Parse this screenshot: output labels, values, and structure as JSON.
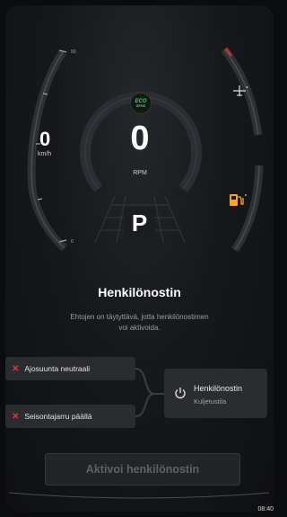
{
  "speedometer": {
    "value": "0",
    "unit": "km/h",
    "tick_top": "50",
    "tick_bottom": "0"
  },
  "tachometer": {
    "value": "0",
    "label": "RPM"
  },
  "eco_badge": {
    "line1": "ECO",
    "line2": "DRIVE"
  },
  "gear": {
    "selected": "P"
  },
  "indicators": {
    "aircraft_icon": "airplane-icon",
    "fuel_icon": "fuel-pump-icon",
    "fuel_color": "#f2a23a"
  },
  "dialog": {
    "title": "Henkilönostin",
    "description_line1": "Ehtojen on täytyttävä, jotta henkilönostimen",
    "description_line2": "voi aktivoida.",
    "conditions": [
      {
        "label": "Ajosuunta neutraali",
        "status": "not-met"
      },
      {
        "label": "Seisontajarru päällä",
        "status": "not-met"
      }
    ],
    "target": {
      "title": "Henkilönostin",
      "subtitle": "Kuljetustila"
    },
    "activate_button": "Aktivoi henkilönostin"
  },
  "status_bar": {
    "time": "08:40"
  },
  "colors": {
    "fail": "#e4343a",
    "eco": "#43d26b",
    "warning": "#f2a23a"
  }
}
